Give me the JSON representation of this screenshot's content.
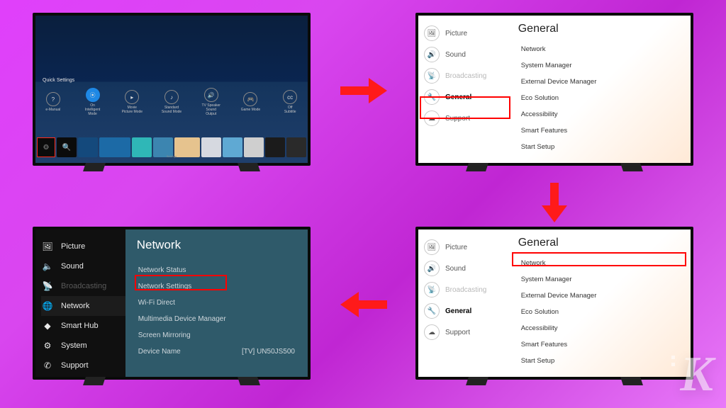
{
  "tv1": {
    "qs_label": "Quick Settings",
    "items": [
      {
        "label": "e-Manual",
        "sub": ""
      },
      {
        "label": "On",
        "sub": "Intelligent Mode"
      },
      {
        "label": "Movie",
        "sub": "Picture Mode"
      },
      {
        "label": "Standard",
        "sub": "Sound Mode"
      },
      {
        "label": "TV Speaker",
        "sub": "Sound Output"
      },
      {
        "label": "",
        "sub": "Game Mode"
      },
      {
        "label": "Off",
        "sub": "Subtitle"
      }
    ],
    "settings_label": "Settings"
  },
  "general_panel": {
    "heading": "General",
    "sidebar": [
      {
        "label": "Picture"
      },
      {
        "label": "Sound"
      },
      {
        "label": "Broadcasting"
      },
      {
        "label": "General"
      },
      {
        "label": "Support"
      }
    ],
    "items": [
      "Network",
      "System Manager",
      "External Device Manager",
      "Eco Solution",
      "Accessibility",
      "Smart Features",
      "Start Setup"
    ]
  },
  "network_panel": {
    "heading": "Network",
    "sidebar": [
      {
        "label": "Picture"
      },
      {
        "label": "Sound"
      },
      {
        "label": "Broadcasting"
      },
      {
        "label": "Network"
      },
      {
        "label": "Smart Hub"
      },
      {
        "label": "System"
      },
      {
        "label": "Support"
      }
    ],
    "items": [
      {
        "label": "Network Status",
        "val": ""
      },
      {
        "label": "Network Settings",
        "val": ""
      },
      {
        "label": "Wi-Fi Direct",
        "val": ""
      },
      {
        "label": "Multimedia Device Manager",
        "val": ""
      },
      {
        "label": "Screen Mirroring",
        "val": ""
      },
      {
        "label": "Device Name",
        "val": "[TV] UN50JS500"
      }
    ]
  },
  "logo": "K"
}
